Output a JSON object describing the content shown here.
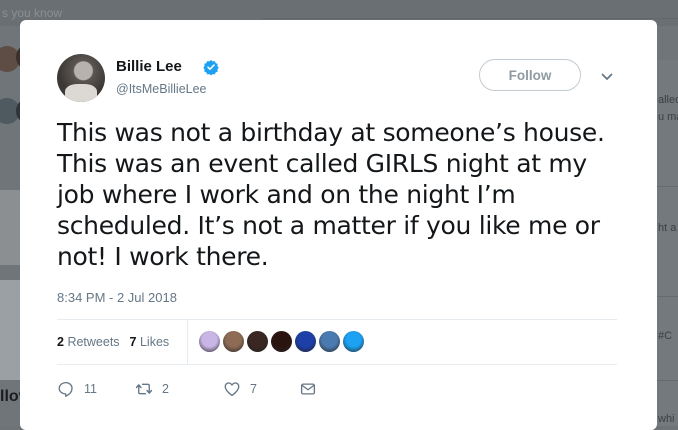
{
  "background": {
    "faded_header_text": "s you know",
    "right_column_texts": [
      "alled",
      "u ma",
      "ht a",
      "#C",
      "whi"
    ],
    "bottom_left_text": "llov"
  },
  "tweet": {
    "display_name": "Billie Lee",
    "handle": "@ItsMeBillieLee",
    "verified": true,
    "follow_label": "Follow",
    "text": "This was not a birthday at someone’s house. This was an event called GIRLS night at my job where I work and on the night I’m scheduled. It’s not a matter if you like me or not! I work there.",
    "timestamp": "8:34 PM - 2 Jul 2018",
    "retweets_count": "2",
    "retweets_label": "Retweets",
    "likes_count": "7",
    "likes_label": "Likes",
    "liker_avatar_colors": [
      "#c9b6e6",
      "#8d6b55",
      "#3a2622",
      "#2b1410",
      "#1d3fa8",
      "#4a7bb0",
      "#1da1f2"
    ],
    "actions": {
      "reply_count": "11",
      "retweet_count": "2",
      "like_count": "7"
    }
  },
  "colors": {
    "accent": "#1da1f2",
    "verified": "#1da1f2",
    "muted_text": "#657786",
    "primary_text": "#14171a",
    "overlay": "#707579"
  }
}
